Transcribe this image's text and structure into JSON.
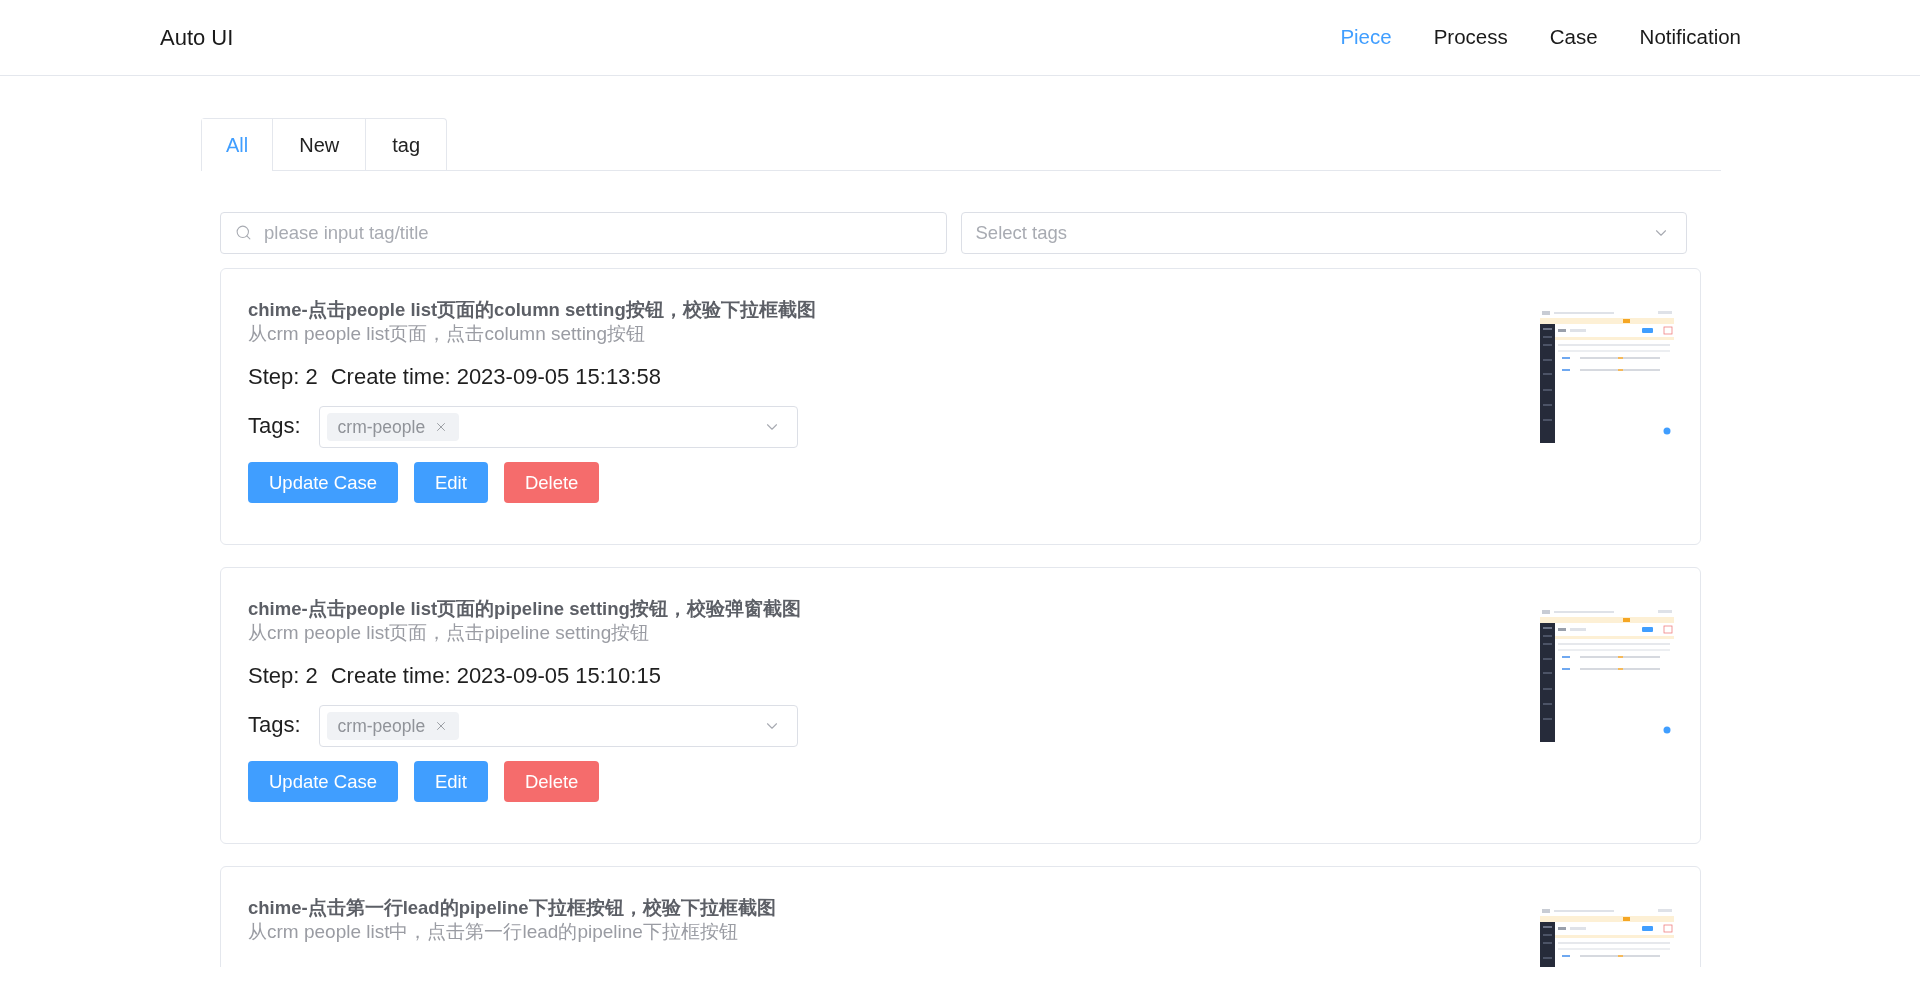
{
  "header": {
    "logo": "Auto UI",
    "nav": [
      {
        "label": "Piece",
        "selected": true
      },
      {
        "label": "Process",
        "selected": false
      },
      {
        "label": "Case",
        "selected": false
      },
      {
        "label": "Notification",
        "selected": false
      }
    ]
  },
  "tabs": [
    {
      "label": "All",
      "selected": true
    },
    {
      "label": "New",
      "selected": false
    },
    {
      "label": "tag",
      "selected": false
    }
  ],
  "search": {
    "placeholder": "please input tag/title"
  },
  "tag_filter": {
    "placeholder": "Select tags"
  },
  "cases": [
    {
      "title": "chime-点击people list页面的column setting按钮，校验下拉框截图",
      "description": "从crm people list页面，点击column setting按钮",
      "step": "Step: 2",
      "created": "Create time: 2023-09-05 15:13:58",
      "tags_label": "Tags:",
      "tags": [
        "crm-people"
      ],
      "buttons": [
        {
          "label": "Update Case",
          "kind": "primary"
        },
        {
          "label": "Edit",
          "kind": "primary"
        },
        {
          "label": "Delete",
          "kind": "danger"
        }
      ]
    },
    {
      "title": "chime-点击people list页面的pipeline setting按钮，校验弹窗截图",
      "description": "从crm people list页面，点击pipeline setting按钮",
      "step": "Step: 2",
      "created": "Create time: 2023-09-05 15:10:15",
      "tags_label": "Tags:",
      "tags": [
        "crm-people"
      ],
      "buttons": [
        {
          "label": "Update Case",
          "kind": "primary"
        },
        {
          "label": "Edit",
          "kind": "primary"
        },
        {
          "label": "Delete",
          "kind": "danger"
        }
      ]
    },
    {
      "title": "chime-点击第一行lead的pipeline下拉框按钮，校验下拉框截图",
      "description": "从crm people list中，点击第一行lead的pipeline下拉框按钮"
    }
  ]
}
